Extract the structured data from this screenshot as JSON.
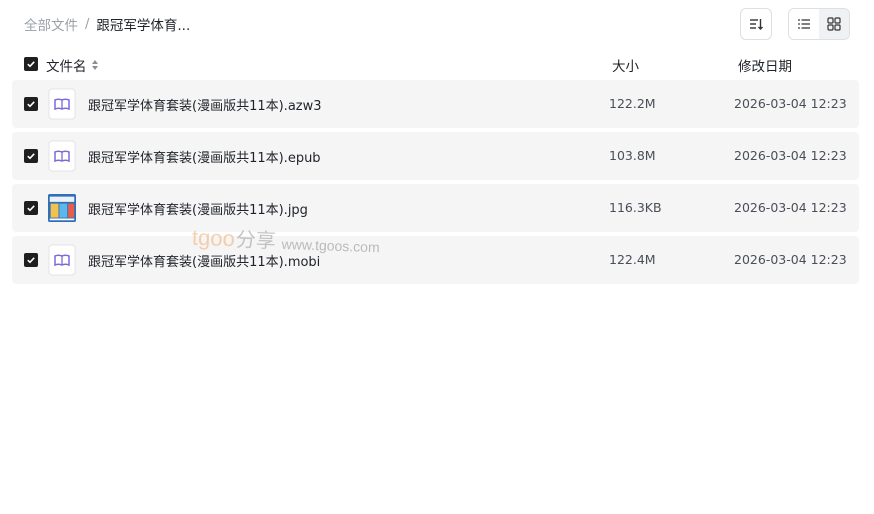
{
  "breadcrumb": {
    "root": "全部文件",
    "separator": "/",
    "current": "跟冠军学体育..."
  },
  "toolbar": {
    "sort_icon": "sort-icon",
    "list_view_icon": "list-view-icon",
    "grid_view_icon": "grid-view-icon"
  },
  "header": {
    "name": "文件名",
    "size": "大小",
    "date": "修改日期"
  },
  "files": [
    {
      "name": "跟冠军学体育套装(漫画版共11本).azw3",
      "size": "122.2M",
      "date": "2026-03-04 12:23",
      "icon": "ebook-file-icon"
    },
    {
      "name": "跟冠军学体育套装(漫画版共11本).epub",
      "size": "103.8M",
      "date": "2026-03-04 12:23",
      "icon": "ebook-file-icon"
    },
    {
      "name": "跟冠军学体育套装(漫画版共11本).jpg",
      "size": "116.3KB",
      "date": "2026-03-04 12:23",
      "icon": "image-thumbnail"
    },
    {
      "name": "跟冠军学体育套装(漫画版共11本).mobi",
      "size": "122.4M",
      "date": "2026-03-04 12:23",
      "icon": "ebook-file-icon"
    }
  ],
  "watermark": {
    "brand_latin": "tgoo",
    "brand_cjk": "分享",
    "url": "www.tgoos.com"
  },
  "colors": {
    "row_background": "#f5f5f6",
    "checkbox": "#1f1f1f",
    "ebook_icon": "#7b6bd8",
    "muted_text": "#9aa0a8"
  }
}
